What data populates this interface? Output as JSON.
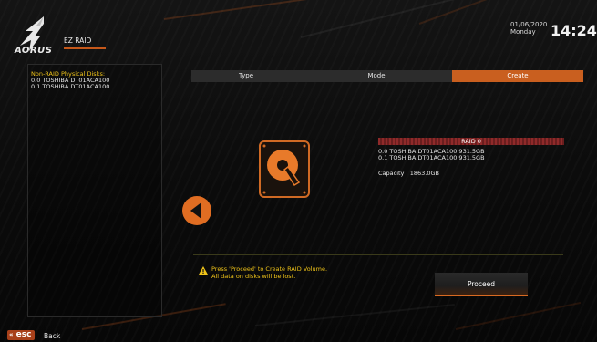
{
  "header": {
    "brand": "AORUS",
    "mode_tab": "EZ RAID",
    "date": "01/06/2020",
    "weekday": "Monday",
    "time": "14:24"
  },
  "left_panel": {
    "title": "Non-RAID Physical Disks:",
    "disks": [
      "0.0  TOSHIBA DT01ACA100",
      "0.1  TOSHIBA DT01ACA100"
    ]
  },
  "tabs": [
    {
      "label": "Type",
      "active": false
    },
    {
      "label": "Mode",
      "active": false
    },
    {
      "label": "Create",
      "active": true
    }
  ],
  "raid": {
    "title": "RAID 0",
    "disks": [
      "0.0  TOSHIBA DT01ACA100 931.5GB",
      "0.1  TOSHIBA DT01ACA100 931.5GB"
    ],
    "capacity": "Capacity : 1863.0GB"
  },
  "warning": {
    "line1": "Press 'Proceed' to Create RAID Volume.",
    "line2": "All data on disks will be lost."
  },
  "proceed_label": "Proceed",
  "footer": {
    "esc_chevron": "«",
    "esc_label": "esc",
    "back_label": "Back"
  },
  "icons": {
    "logo": "aorus-eagle-icon",
    "disk": "hard-disk-icon",
    "back": "back-arrow-icon",
    "warning": "warning-icon"
  },
  "colors": {
    "accent": "#c95f1f",
    "warning": "#f0c419",
    "raid_banner": "#8f2a2a",
    "background": "#0a0a0a"
  }
}
